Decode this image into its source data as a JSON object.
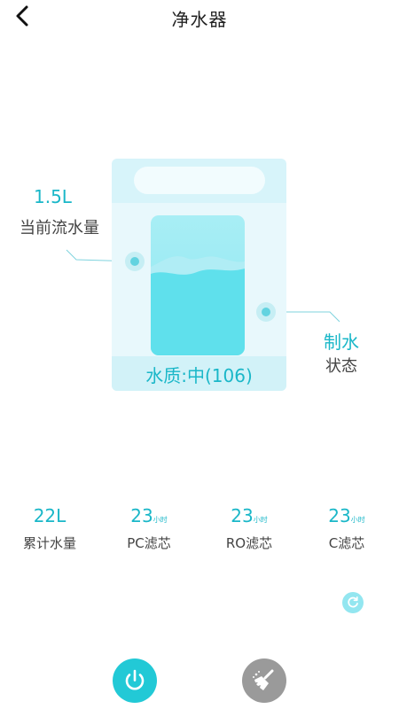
{
  "header": {
    "title": "净水器",
    "back_icon": "chevron-left-icon"
  },
  "tank": {
    "quality_label": "水质:中(106)"
  },
  "flow": {
    "value": "1.5L",
    "label": "当前流水量"
  },
  "production": {
    "value": "制水",
    "label": "状态"
  },
  "stats": [
    {
      "value": "22L",
      "unit": "",
      "label": "累计水量"
    },
    {
      "value": "23",
      "unit": "小时",
      "label": "PC滤芯"
    },
    {
      "value": "23",
      "unit": "小时",
      "label": "RO滤芯"
    },
    {
      "value": "23",
      "unit": "小时",
      "label": "C滤芯"
    }
  ],
  "controls": {
    "refresh_icon": "refresh-icon",
    "power_icon": "power-icon",
    "clean_icon": "broom-icon"
  },
  "colors": {
    "accent": "#1ab7c8",
    "power_button": "#22c9d6",
    "clean_button": "#9a9a9a",
    "tank_light": "#e8f8fc",
    "water": "#5fe0ec"
  }
}
